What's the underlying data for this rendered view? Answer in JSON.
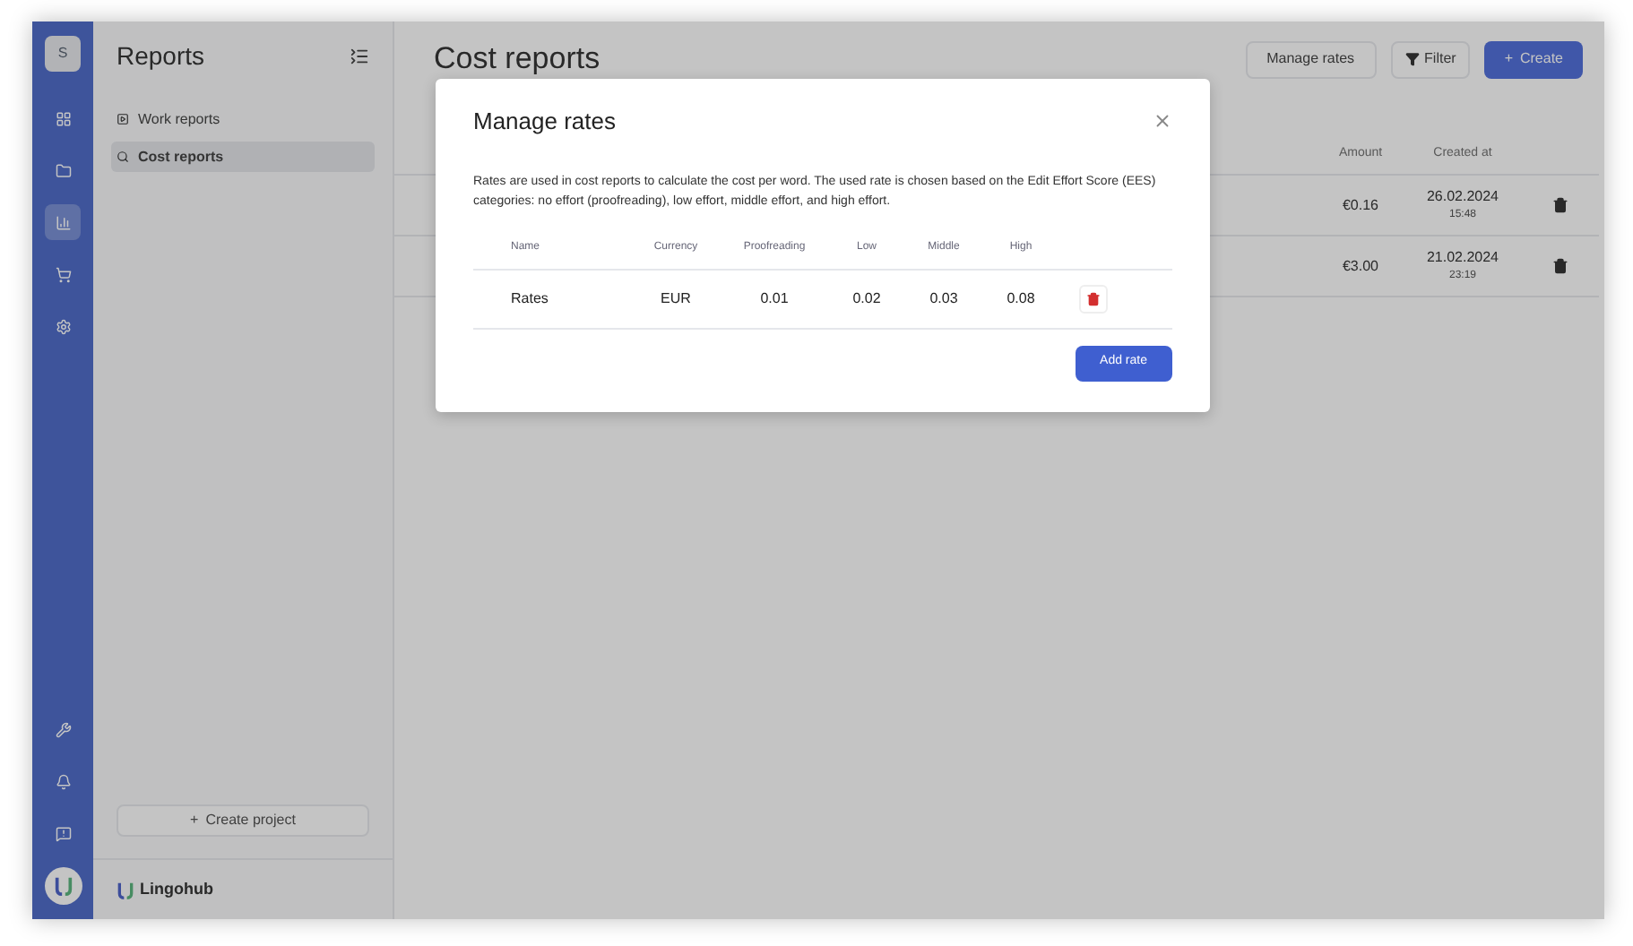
{
  "rail": {
    "account_initial": "S",
    "items": [
      {
        "kind": "apps",
        "selected": false
      },
      {
        "kind": "projects",
        "selected": false
      },
      {
        "kind": "reports",
        "selected": true
      },
      {
        "kind": "cart",
        "selected": false
      },
      {
        "kind": "settings",
        "selected": false
      }
    ],
    "bottom_items": [
      {
        "kind": "tools"
      },
      {
        "kind": "notifications"
      },
      {
        "kind": "help"
      }
    ]
  },
  "sidebar": {
    "title": "Reports",
    "items": [
      {
        "label": "Work reports",
        "kind": "work",
        "selected": false
      },
      {
        "label": "Cost reports",
        "kind": "cost",
        "selected": true
      }
    ],
    "create_button": {
      "icon": "+",
      "label": "Create project"
    },
    "brand": "Lingohub"
  },
  "main": {
    "title": "Cost reports",
    "buttons": [
      {
        "label": "Manage rates",
        "kind": "outline"
      },
      {
        "label": "Filter",
        "kind": "filter"
      },
      {
        "label": "Create",
        "kind": "primary",
        "icon": "+"
      }
    ],
    "table": {
      "columns": [
        "Amount",
        "Created at"
      ],
      "rows": [
        {
          "amount": "€0.16",
          "date": "26.02.2024",
          "time": "15:48"
        },
        {
          "amount": "€3.00",
          "date": "21.02.2024",
          "time": "23:19"
        }
      ]
    }
  },
  "modal": {
    "title": "Manage rates",
    "description": "Rates are used in cost reports to calculate the cost per word. The used rate is chosen based on the Edit Effort Score (EES) categories: no effort (proofreading), low effort, middle effort, and high effort.",
    "table": {
      "columns": [
        "Name",
        "Currency",
        "Proofreading",
        "Low",
        "Middle",
        "High"
      ],
      "rows": [
        [
          "Rates",
          "EUR",
          "0.01",
          "0.02",
          "0.03",
          "0.08"
        ]
      ]
    },
    "add_button": "Add rate"
  }
}
